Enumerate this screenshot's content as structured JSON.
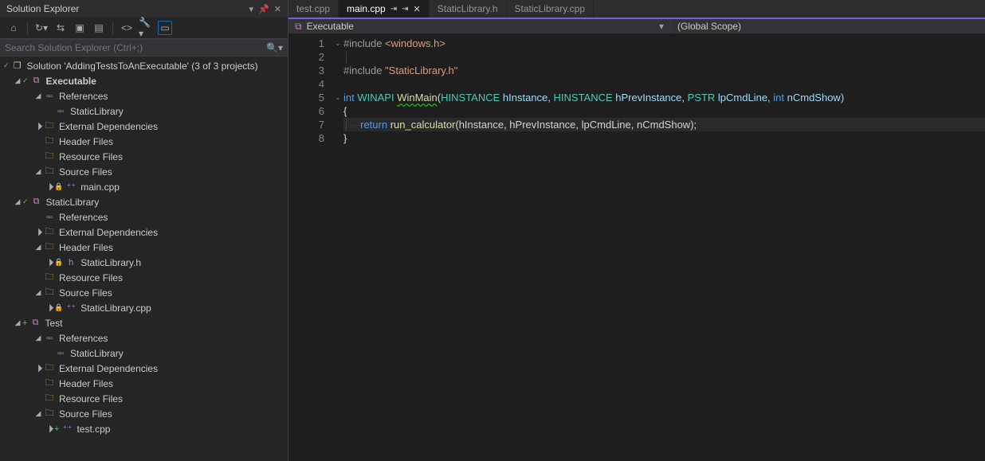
{
  "panel": {
    "title": "Solution Explorer",
    "search_placeholder": "Search Solution Explorer (Ctrl+;)",
    "solution_line": "Solution 'AddingTestsToAnExecutable' (3 of 3 projects)"
  },
  "tree": {
    "proj1": {
      "name": "Executable",
      "refs": "References",
      "ref1": "StaticLibrary",
      "extdep": "External Dependencies",
      "headers": "Header Files",
      "resources": "Resource Files",
      "sources": "Source Files",
      "src1": "main.cpp"
    },
    "proj2": {
      "name": "StaticLibrary",
      "refs": "References",
      "extdep": "External Dependencies",
      "headers": "Header Files",
      "hdr1": "StaticLibrary.h",
      "resources": "Resource Files",
      "sources": "Source Files",
      "src1": "StaticLibrary.cpp"
    },
    "proj3": {
      "name": "Test",
      "refs": "References",
      "ref1": "StaticLibrary",
      "extdep": "External Dependencies",
      "headers": "Header Files",
      "resources": "Resource Files",
      "sources": "Source Files",
      "src1": "test.cpp"
    }
  },
  "tabs": {
    "t1": "test.cpp",
    "t2": "main.cpp",
    "t3": "StaticLibrary.h",
    "t4": "StaticLibrary.cpp"
  },
  "context": {
    "left": "Executable",
    "right": "(Global Scope)"
  },
  "code": {
    "lines": [
      "1",
      "2",
      "3",
      "4",
      "5",
      "6",
      "7",
      "8"
    ],
    "l1": {
      "a": "#include ",
      "b": "<windows.h>"
    },
    "l3": {
      "a": "#include ",
      "b": "\"StaticLibrary.h\""
    },
    "l5": {
      "kw_int": "int",
      "winapi": "WINAPI",
      "fn": "WinMain",
      "p": "(",
      "t1": "HINSTANCE",
      "n1": " hInstance, ",
      "t2": "HINSTANCE",
      "n2": " hPrevInstance, ",
      "t3": "PSTR",
      "n3": " lpCmdLine, ",
      "kw_int2": "int",
      "n4": " nCmdShow)"
    },
    "l6": "{",
    "l7": {
      "ret": "return",
      "sp": " ",
      "fn": "run_calculator",
      "args": "(hInstance, hPrevInstance, lpCmdLine, nCmdShow);"
    },
    "l8": "}"
  }
}
